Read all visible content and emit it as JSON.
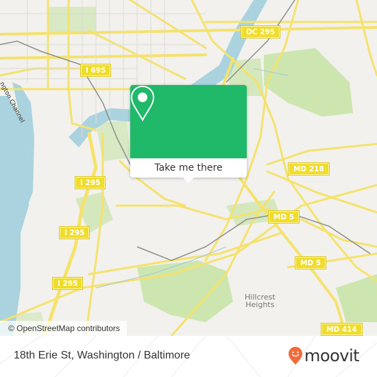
{
  "map": {
    "colors": {
      "land": "#f2f1ed",
      "water": "#aad3df",
      "park": "#cde6b0",
      "road": "#f5e26b",
      "rail": "#8c8c8c"
    },
    "road_shields": [
      {
        "label": "I 695",
        "id": "i695"
      },
      {
        "label": "DC 295",
        "id": "dc295"
      },
      {
        "label": "I 295",
        "id": "i295a"
      },
      {
        "label": "I 295",
        "id": "i295b"
      },
      {
        "label": "I 295",
        "id": "i295c"
      },
      {
        "label": "MD 218",
        "id": "md218"
      },
      {
        "label": "MD 5",
        "id": "md5a"
      },
      {
        "label": "MD 5",
        "id": "md5b"
      },
      {
        "label": "MD 414",
        "id": "md414"
      }
    ],
    "place_labels": {
      "hillcrest_line1": "Hillcrest",
      "hillcrest_line2": "Heights",
      "channel": "ngton Channel"
    },
    "attribution": "© OpenStreetMap contributors"
  },
  "popup": {
    "icon": "map-pin-icon",
    "button_label": "Take me there",
    "accent_color": "#1fb969"
  },
  "footer": {
    "address": "18th Erie St, Washington / Baltimore",
    "logo_text": "moovit",
    "logo_color": "#f26b3a"
  }
}
